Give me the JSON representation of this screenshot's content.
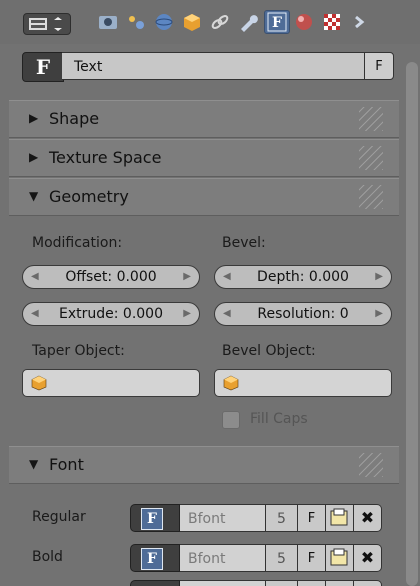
{
  "header": {
    "tabs": [
      {
        "name": "render-tab",
        "icon": "camera-icon"
      },
      {
        "name": "scene-tab",
        "icon": "scene-icon"
      },
      {
        "name": "world-tab",
        "icon": "world-icon"
      },
      {
        "name": "object-tab",
        "icon": "cube-icon"
      },
      {
        "name": "constraints-tab",
        "icon": "chain-link-icon"
      },
      {
        "name": "modifiers-tab",
        "icon": "wrench-icon"
      },
      {
        "name": "data-tab",
        "icon": "font-data-icon",
        "active": true
      },
      {
        "name": "material-tab",
        "icon": "material-sphere-icon"
      },
      {
        "name": "texture-tab",
        "icon": "checker-texture-icon"
      }
    ]
  },
  "datablock": {
    "type_icon_text": "F",
    "name": "Text",
    "fake_user": "F"
  },
  "panels": {
    "shape": {
      "title": "Shape",
      "expanded": false
    },
    "texture_space": {
      "title": "Texture Space",
      "expanded": false
    },
    "geometry": {
      "title": "Geometry",
      "expanded": true,
      "modification_label": "Modification:",
      "bevel_label": "Bevel:",
      "offset": "Offset: 0.000",
      "extrude": "Extrude: 0.000",
      "depth": "Depth: 0.000",
      "resolution": "Resolution: 0",
      "taper_label": "Taper Object:",
      "bevel_object_label": "Bevel Object:",
      "fill_caps": "Fill Caps"
    },
    "font": {
      "title": "Font",
      "expanded": true,
      "rows": [
        {
          "label": "Regular",
          "font_name": "Bfont",
          "users": "5",
          "fake_user": "F"
        },
        {
          "label": "Bold",
          "font_name": "Bfont",
          "users": "5",
          "fake_user": "F"
        }
      ]
    }
  },
  "colors": {
    "panel_bg": "#727272",
    "header_bg": "#7d7d7d",
    "active_tab": "#4f6c97",
    "field_bg": "#bdbdbd"
  }
}
